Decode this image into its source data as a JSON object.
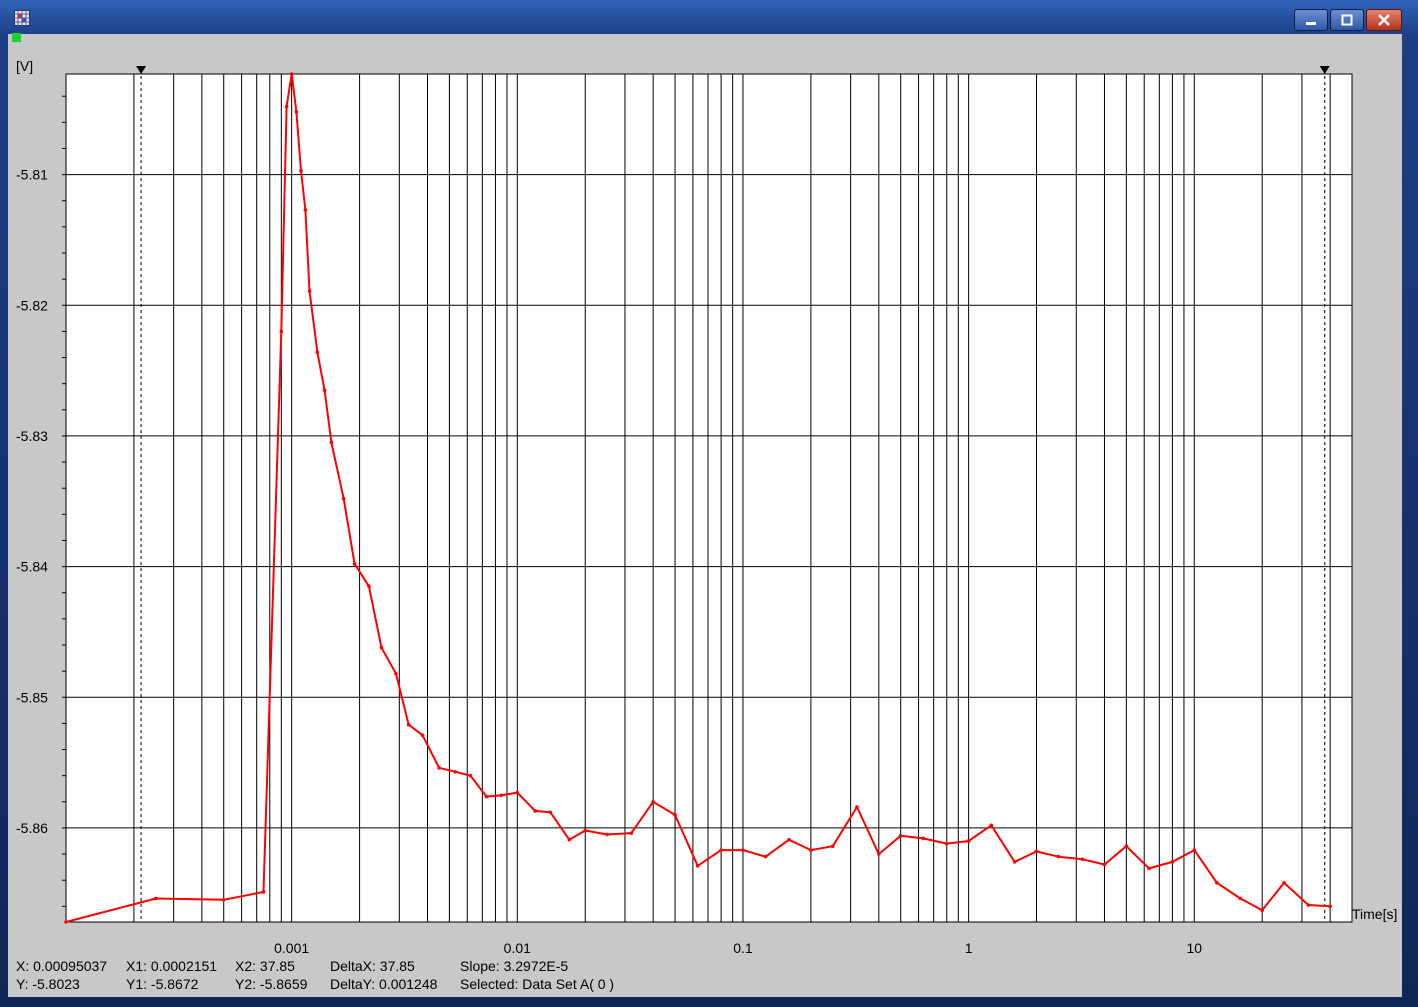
{
  "window": {
    "title": "",
    "icon": "grid-app-icon",
    "controls": [
      "minimize-icon",
      "maximize-icon",
      "close-icon"
    ],
    "status_color": "#16d62a"
  },
  "chart_data": {
    "type": "line",
    "xscale": "log",
    "xlim": [
      0.0001,
      50
    ],
    "ylim": [
      -5.8672,
      -5.8023
    ],
    "ylabel": "[V]",
    "xlabel": "Time[s]",
    "grid": true,
    "series_color": "#ff0000",
    "background": "#ffffff",
    "yticks": [
      {
        "value": -5.81,
        "label": "-5.81"
      },
      {
        "value": -5.82,
        "label": "-5.82"
      },
      {
        "value": -5.83,
        "label": "-5.83"
      },
      {
        "value": -5.84,
        "label": "-5.84"
      },
      {
        "value": -5.85,
        "label": "-5.85"
      },
      {
        "value": -5.86,
        "label": "-5.86"
      }
    ],
    "xticks": [
      {
        "value": 0.001,
        "label": "0.001"
      },
      {
        "value": 0.01,
        "label": "0.01"
      },
      {
        "value": 0.1,
        "label": "0.1"
      },
      {
        "value": 1,
        "label": "1"
      },
      {
        "value": 10,
        "label": "10"
      }
    ],
    "cursors": [
      0.0002151,
      37.85
    ],
    "series": [
      {
        "x": [
          0.0001,
          0.00025,
          0.0005,
          0.00075,
          0.0009,
          0.00095,
          0.001,
          0.00105,
          0.0011,
          0.00115,
          0.0012,
          0.0013,
          0.0014,
          0.0015,
          0.0017,
          0.0019,
          0.0022,
          0.0025,
          0.0029,
          0.0033,
          0.0038,
          0.0045,
          0.0053,
          0.0062,
          0.0073,
          0.0085,
          0.01,
          0.012,
          0.014,
          0.017,
          0.02,
          0.025,
          0.032,
          0.04,
          0.05,
          0.063,
          0.08,
          0.1,
          0.126,
          0.16,
          0.2,
          0.25,
          0.32,
          0.4,
          0.5,
          0.63,
          0.8,
          1.0,
          1.26,
          1.6,
          2.0,
          2.5,
          3.2,
          4.0,
          5.0,
          6.3,
          8.0,
          10,
          12.6,
          16,
          20,
          25,
          32,
          40
        ],
        "y": [
          -5.8672,
          -5.8654,
          -5.8655,
          -5.8649,
          -5.822,
          -5.8048,
          -5.8023,
          -5.8052,
          -5.8097,
          -5.8127,
          -5.8189,
          -5.8236,
          -5.8265,
          -5.8305,
          -5.8348,
          -5.8398,
          -5.8415,
          -5.8462,
          -5.8482,
          -5.8521,
          -5.8529,
          -5.8554,
          -5.8557,
          -5.856,
          -5.8576,
          -5.8575,
          -5.8573,
          -5.8587,
          -5.8588,
          -5.8609,
          -5.8602,
          -5.8605,
          -5.8604,
          -5.858,
          -5.859,
          -5.8629,
          -5.8617,
          -5.8617,
          -5.8622,
          -5.8609,
          -5.8617,
          -5.8614,
          -5.8584,
          -5.862,
          -5.8606,
          -5.8608,
          -5.8612,
          -5.861,
          -5.8598,
          -5.8626,
          -5.8618,
          -5.8622,
          -5.8624,
          -5.8628,
          -5.8614,
          -5.8631,
          -5.8626,
          -5.8617,
          -5.8642,
          -5.8654,
          -5.8663,
          -5.8642,
          -5.8659,
          -5.866
        ]
      }
    ]
  },
  "readouts": {
    "x": "X: 0.00095037",
    "y": "Y: -5.8023",
    "x1": "X1: 0.0002151",
    "y1": "Y1: -5.8672",
    "x2": "X2: 37.85",
    "y2": "Y2: -5.8659",
    "deltax": "DeltaX: 37.85",
    "deltay": "DeltaY: 0.001248",
    "slope": "Slope: 3.2972E-5",
    "selected": "Selected: Data Set A( 0 )"
  }
}
